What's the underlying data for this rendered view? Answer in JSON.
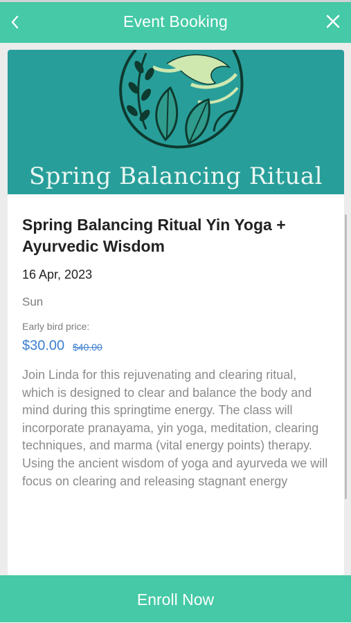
{
  "header": {
    "title": "Event Booking",
    "back_icon": "chevron-left-icon",
    "close_icon": "close-icon",
    "color": "#45c9a6"
  },
  "banner": {
    "text": "Spring Balancing Ritual",
    "background": "#289e9a"
  },
  "event": {
    "title": "Spring Balancing Ritual Yin Yoga + Ayurvedic Wisdom",
    "date": "16 Apr, 2023",
    "day": "Sun",
    "early_bird_label": "Early bird price:",
    "price": "$30.00",
    "original_price": "$40.00",
    "description": [
      "Join Linda for this rejuvenating and clearing ritual, which is designed to clear and balance the body and",
      "mind during this springtime energy. The class will incorporate pranayama, yin yoga, meditation, clearing",
      "techniques, and marma (vital energy points) therapy.",
      "Using the ancient wisdom of yoga and ayurveda we will focus on clearing and releasing stagnant energy"
    ]
  },
  "footer": {
    "enroll_label": "Enroll Now"
  }
}
